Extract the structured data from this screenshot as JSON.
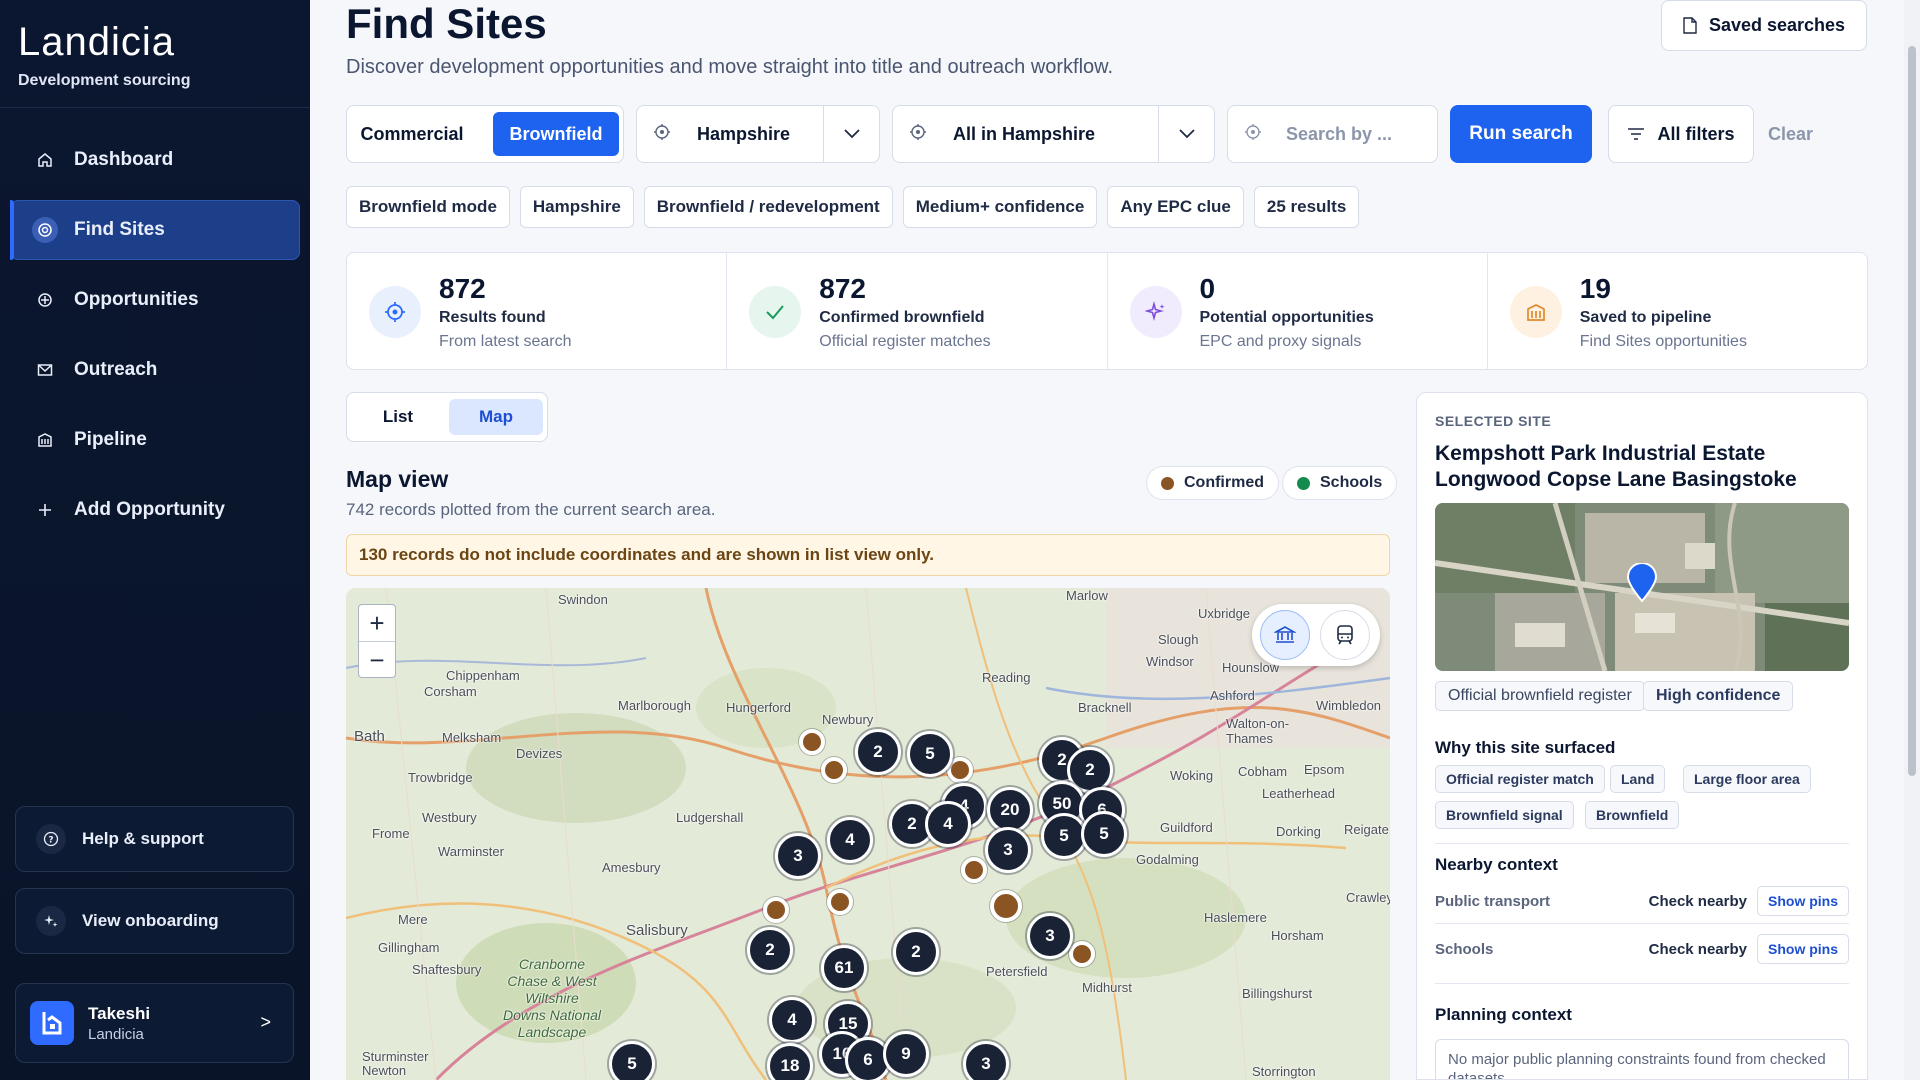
{
  "app": {
    "brand": "Landicia",
    "brand_subtitle": "Development sourcing"
  },
  "sidebar": {
    "items": [
      {
        "label": "Dashboard",
        "icon": "home-icon"
      },
      {
        "label": "Find Sites",
        "icon": "target-icon",
        "active": true
      },
      {
        "label": "Opportunities",
        "icon": "crosshair-icon"
      },
      {
        "label": "Outreach",
        "icon": "mail-icon"
      },
      {
        "label": "Pipeline",
        "icon": "building-icon"
      },
      {
        "label": "Add Opportunity",
        "icon": "plus-icon"
      }
    ],
    "help_label": "Help & support",
    "onboarding_label": "View onboarding",
    "user_name": "Takeshi",
    "user_org": "Landicia"
  },
  "header": {
    "title": "Find Sites",
    "subtitle": "Discover development opportunities and move straight into title and outreach workflow.",
    "saved_searches_label": "Saved searches"
  },
  "filters": {
    "mode_options": [
      "Commercial",
      "Brownfield"
    ],
    "mode_selected": "Brownfield",
    "county": "Hampshire",
    "area": "All in Hampshire",
    "search_placeholder": "Search by ...",
    "run_label": "Run search",
    "all_filters_label": "All filters",
    "clear_label": "Clear"
  },
  "chips": [
    "Brownfield mode",
    "Hampshire",
    "Brownfield / redevelopment",
    "Medium+ confidence",
    "Any EPC clue",
    "25 results"
  ],
  "stats": [
    {
      "value": "872",
      "label": "Results found",
      "sub": "From latest search",
      "icon": "target-icon",
      "color": "#e8f0fe"
    },
    {
      "value": "872",
      "label": "Confirmed brownfield",
      "sub": "Official register matches",
      "icon": "check-icon",
      "color": "#e6f6ee"
    },
    {
      "value": "0",
      "label": "Potential opportunities",
      "sub": "EPC and proxy signals",
      "icon": "sparkle-icon",
      "color": "#f1ecfd"
    },
    {
      "value": "19",
      "label": "Saved to pipeline",
      "sub": "Find Sites opportunities",
      "icon": "building-icon",
      "color": "#fff1e2"
    }
  ],
  "view_toggle": {
    "list": "List",
    "map": "Map",
    "selected": "Map"
  },
  "map_view": {
    "title": "Map view",
    "subtitle": "742 records plotted from the current search area.",
    "legend_confirmed": "Confirmed",
    "legend_schools": "Schools",
    "confirmed_color": "#8a5523",
    "schools_color": "#138a4e",
    "notice": "130 records do not include coordinates and are shown in list view only.",
    "zoom_in": "+",
    "zoom_out": "−",
    "places": [
      "Swindon",
      "Marlow",
      "Uxbridge",
      "Slough",
      "Windsor",
      "Hounslow",
      "Chippenham",
      "Corsham",
      "Reading",
      "Bracknell",
      "Ashford",
      "Wimbledon",
      "Bath",
      "Melksham",
      "Devizes",
      "Marlborough",
      "Hungerford",
      "Newbury",
      "Walton-on-Thames",
      "Trowbridge",
      "Woking",
      "Cobham",
      "Epsom",
      "Leatherhead",
      "Westbury",
      "Ludgershall",
      "Frome",
      "Warminster",
      "Guildford",
      "Dorking",
      "Reigate",
      "Amesbury",
      "Godalming",
      "Mere",
      "Salisbury",
      "Gillingham",
      "Shaftesbury",
      "Haslemere",
      "Horsham",
      "Crawley",
      "Petersfield",
      "Midhurst",
      "Billingshurst",
      "Sturminster Newton",
      "Storrington",
      "Cranborne Chase & West Wiltshire Downs National Landscape"
    ],
    "clusters": [
      "2",
      "5",
      "2",
      "2",
      "4",
      "20",
      "50",
      "6",
      "2",
      "4",
      "4",
      "5",
      "5",
      "3",
      "3",
      "3",
      "2",
      "61",
      "2",
      "4",
      "15",
      "18",
      "16",
      "6",
      "9",
      "5",
      "3"
    ]
  },
  "selected_site": {
    "eyebrow": "SELECTED SITE",
    "title": "Kempshott Park Industrial Estate Longwood Copse Lane Basingstoke",
    "tags": [
      "Official brownfield register",
      "High confidence"
    ],
    "why_heading": "Why this site surfaced",
    "why_tags": [
      "Official register match",
      "Land",
      "Large floor area",
      "Brownfield signal",
      "Brownfield"
    ],
    "nearby_heading": "Nearby context",
    "nearby": [
      {
        "label": "Public transport",
        "status": "Check nearby",
        "action": "Show pins"
      },
      {
        "label": "Schools",
        "status": "Check nearby",
        "action": "Show pins"
      }
    ],
    "planning_heading": "Planning context",
    "planning_text": "No major public planning constraints found from checked datasets."
  }
}
